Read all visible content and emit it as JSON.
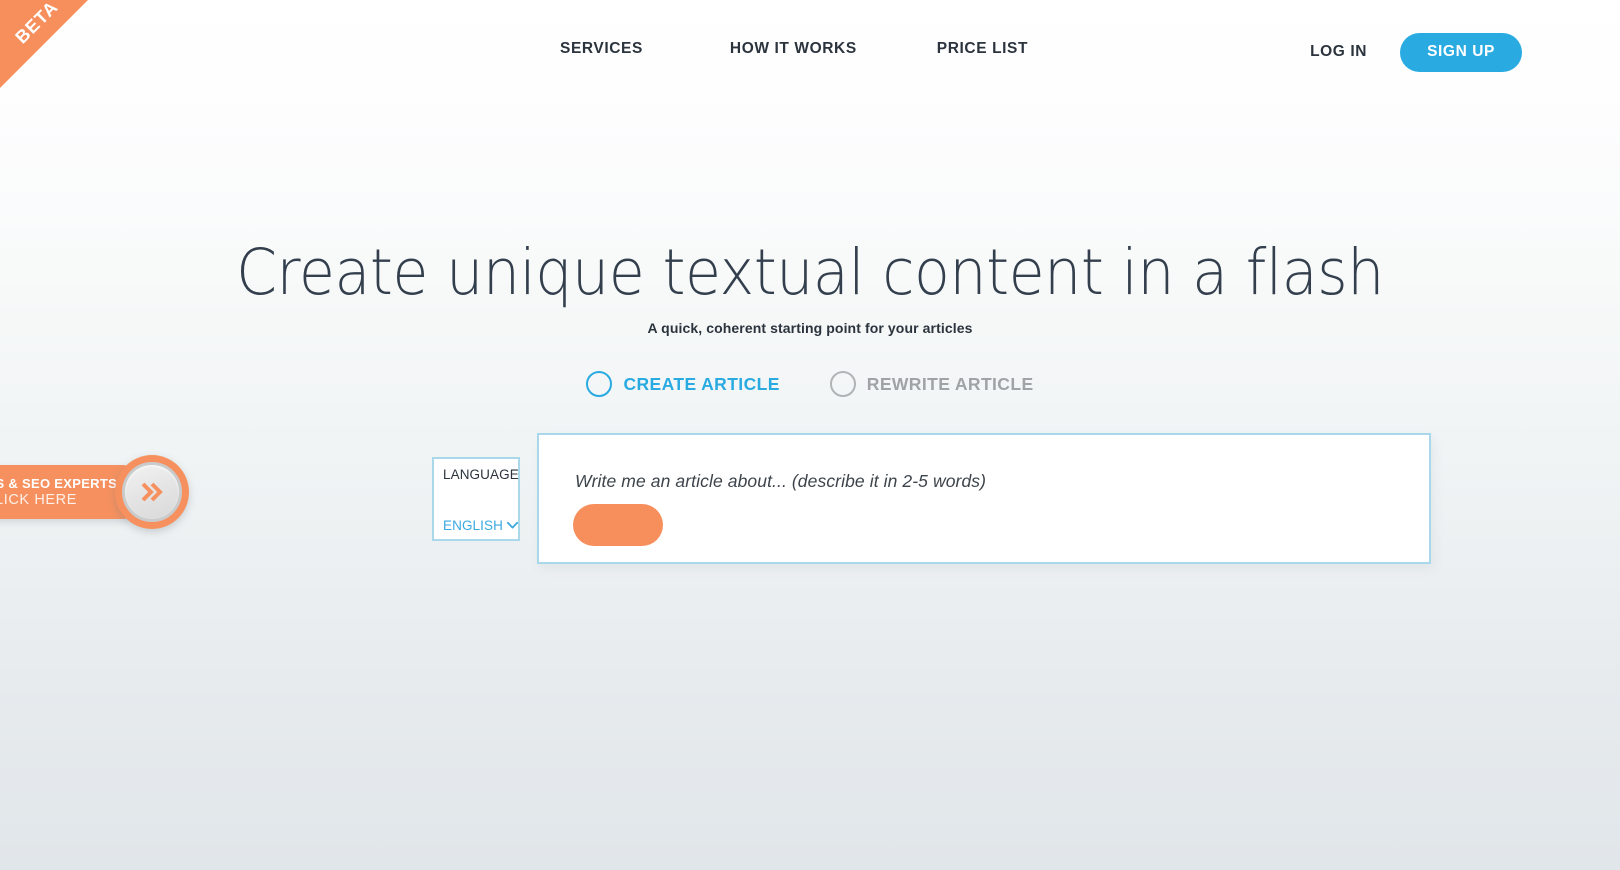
{
  "theme": {
    "accent_blue": "#29abe2",
    "accent_orange": "#f78f5c",
    "border_blue": "#a9d8ea",
    "text_dark": "#2b333d",
    "text_muted": "#a0a3a6"
  },
  "ribbon": {
    "label": "BETA"
  },
  "header": {
    "nav": [
      {
        "label": "SERVICES",
        "name": "nav-link-services"
      },
      {
        "label": "HOW IT WORKS",
        "name": "nav-link-how-it-works"
      },
      {
        "label": "PRICE LIST",
        "name": "nav-link-price-list"
      }
    ],
    "login_label": "LOG IN",
    "signup_label": "SIGN UP"
  },
  "hero": {
    "title": "Create unique textual content in a flash",
    "subtitle": "A quick, coherent starting point for your articles"
  },
  "mode_selector": {
    "options": [
      {
        "label": "CREATE ARTICLE",
        "selected": true
      },
      {
        "label": "REWRITE ARTICLE",
        "selected": false
      }
    ]
  },
  "form": {
    "language": {
      "label": "LANGUAGE",
      "value": "ENGLISH",
      "options": [
        "ENGLISH"
      ],
      "chevron_icon": "chevron-down-icon"
    },
    "prompt": {
      "value": "",
      "placeholder": "Write me an article about... (describe it in 2-5 words)"
    },
    "submit_label": ""
  },
  "promo_widget": {
    "line1": "GENCIES & SEO EXPERTS",
    "line2": "CLICK HERE",
    "knob_icon": "double-chevron-right-icon"
  }
}
